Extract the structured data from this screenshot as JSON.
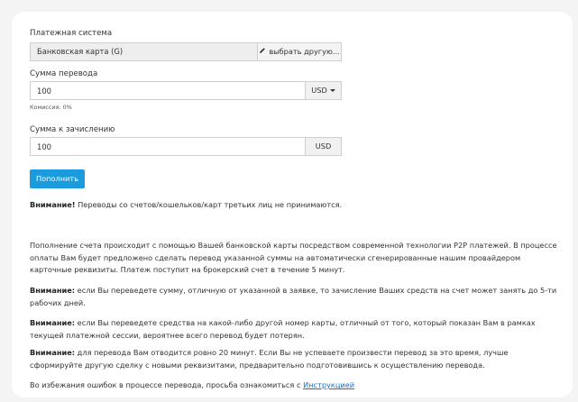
{
  "form": {
    "payment_system_label": "Платежная система",
    "payment_system_value": "Банковская карта (G)",
    "choose_other_label": "выбрать другую...",
    "amount_label": "Сумма перевода",
    "amount_value": "100",
    "amount_currency": "USD",
    "commission_text": "Комиссия: 0%",
    "credit_label": "Сумма к зачислению",
    "credit_value": "100",
    "credit_currency": "USD",
    "submit_label": "Пополнить"
  },
  "notices": {
    "warning_bold": "Внимание!",
    "warning_text": " Переводы со счетов/кошельков/карт третьих лиц не принимаются.",
    "p2p_text": "Пополнение счета происходит с помощью Вашей банковской карты посредством современной технологии P2P платежей. В процессе оплаты Вам будет предложено сделать перевод указанной суммы на автоматически сгенерированные нашим провайдером карточные реквизиты. Платеж поступит на брокерский счет в течение 5 минут.",
    "note1_bold": "Внимание:",
    "note1_text": " если Вы переведете сумму, отличную от указанной в заявке, то зачисление Ваших средств на счет может занять до 5-ти рабочих дней.",
    "note2_bold": "Внимание:",
    "note2_text": " если Вы переведете средства на какой-либо другой номер карты, отличный от того, который показан Вам в рамках текущей платежной сессии, вероятнее всего перевод будет потерян.",
    "note3_bold": "Внимание:",
    "note3_text": " для перевода Вам отводится ровно 20 минут. Если Вы не успеваете произвести перевод за это время, лучше сформируйте другую сделку с новыми реквизитами, предварительно подготовившись к осуществлению перевода.",
    "instructions_text": "Во избежания ошибок в процессе перевода, просьба ознакомиться с ",
    "instructions_link": "Инструкцией"
  },
  "icons": {
    "choose_other": "pencil-icon",
    "currency_dropdown": "caret-down-icon"
  },
  "colors": {
    "primary_button": "#1a9bdd",
    "link": "#1a6dc9"
  }
}
